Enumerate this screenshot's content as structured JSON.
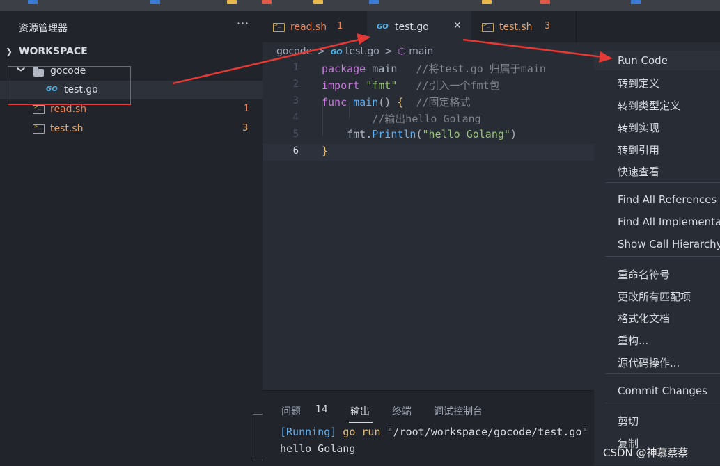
{
  "sidebar": {
    "title": "资源管理器",
    "more": "···",
    "workspace_label": "WORKSPACE",
    "items": [
      {
        "label": "gocode",
        "type": "folder"
      },
      {
        "label": "test.go",
        "type": "go"
      },
      {
        "label": "read.sh",
        "type": "sh",
        "badge": "1"
      },
      {
        "label": "test.sh",
        "type": "sh",
        "badge": "3"
      }
    ]
  },
  "tabs": [
    {
      "label": "read.sh",
      "badge": "1",
      "icon": "shell-icon"
    },
    {
      "label": "test.go",
      "close": "✕",
      "icon": "go-icon",
      "active": true
    },
    {
      "label": "test.sh",
      "badge": "3",
      "icon": "shell-icon"
    }
  ],
  "breadcrumb": {
    "folder": "gocode",
    "file": "test.go",
    "symbol": "main",
    "sep": ">"
  },
  "editor": {
    "line_numbers": [
      "1",
      "2",
      "3",
      "4",
      "5",
      "6"
    ],
    "lines": [
      [
        {
          "t": "package",
          "c": "kw"
        },
        {
          "t": " main",
          "c": "pl"
        },
        {
          "t": "   //将test.go 归属于main",
          "c": "cm"
        }
      ],
      [
        {
          "t": "import",
          "c": "kw"
        },
        {
          "t": " ",
          "c": "pl"
        },
        {
          "t": "\"fmt\"",
          "c": "str"
        },
        {
          "t": "   //引入一个fmt包",
          "c": "cm"
        }
      ],
      [
        {
          "t": "func",
          "c": "kw"
        },
        {
          "t": " ",
          "c": "pl"
        },
        {
          "t": "main",
          "c": "fn"
        },
        {
          "t": "()",
          "c": "pl"
        },
        {
          "t": " {",
          "c": "br"
        },
        {
          "t": "  //固定格式",
          "c": "cm"
        }
      ],
      [
        {
          "t": "        //输出hello Golang",
          "c": "cm"
        }
      ],
      [
        {
          "t": "    fmt",
          "c": "pl"
        },
        {
          "t": ".",
          "c": "pl"
        },
        {
          "t": "Println",
          "c": "fn"
        },
        {
          "t": "(",
          "c": "pl"
        },
        {
          "t": "\"hello Golang\"",
          "c": "str"
        },
        {
          "t": ")",
          "c": "pl"
        }
      ],
      [
        {
          "t": "}",
          "c": "br"
        }
      ]
    ]
  },
  "panel": {
    "tabs": [
      {
        "label": "问题"
      },
      {
        "label": "14"
      },
      {
        "label": "输出",
        "active": true
      },
      {
        "label": "终端"
      },
      {
        "label": "调试控制台"
      }
    ],
    "output": {
      "running": "[Running]",
      "cmd": " go run ",
      "path": "\"/root/workspace/gocode/test.go\"",
      "result": "hello Golang"
    }
  },
  "context_menu": {
    "items": [
      {
        "label": "Run Code",
        "highlight": true
      },
      {
        "label": "转到定义"
      },
      {
        "label": "转到类型定义"
      },
      {
        "label": "转到实现"
      },
      {
        "label": "转到引用"
      },
      {
        "label": "快速查看"
      },
      {
        "label": "Find All References"
      },
      {
        "label": "Find All Implementations"
      },
      {
        "label": "Show Call Hierarchy"
      },
      {
        "label": "重命名符号"
      },
      {
        "label": "更改所有匹配项"
      },
      {
        "label": "格式化文档"
      },
      {
        "label": "重构..."
      },
      {
        "label": "源代码操作..."
      },
      {
        "label": "Commit Changes"
      },
      {
        "label": "剪切"
      },
      {
        "label": "复制"
      }
    ]
  },
  "watermark": "CSDN @神慕蔡蔡",
  "colors": {
    "accent_red": "#e53935",
    "sidebar_bg": "#21252b",
    "editor_bg": "#282c34",
    "sh_color": "#e8865c",
    "go_icon": "#4fb3e8"
  }
}
